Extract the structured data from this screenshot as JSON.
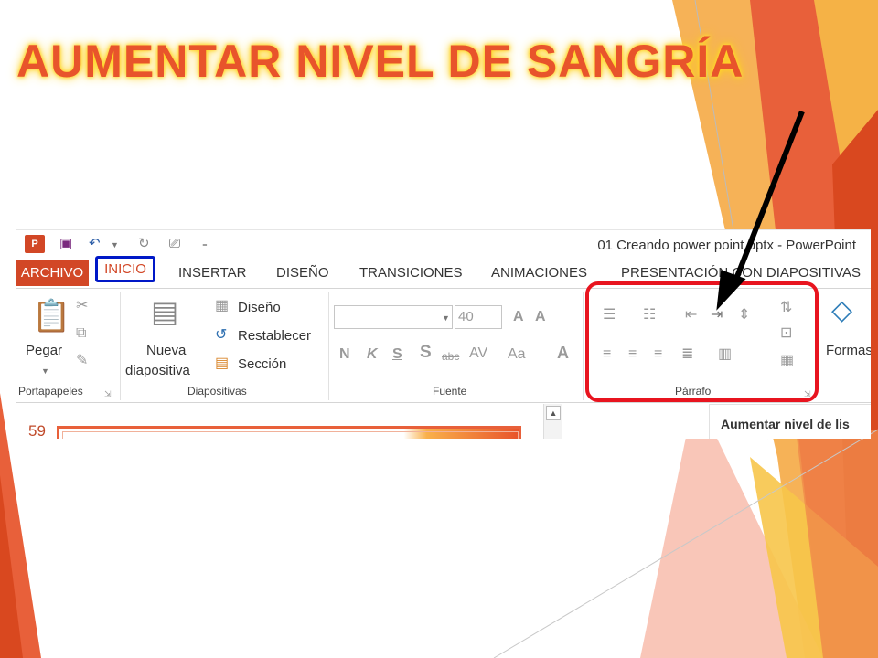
{
  "slide": {
    "title": "AUMENTAR NIVEL DE SANGRÍA",
    "accent_color": "#e8542b",
    "highlight_color": "#e8141f",
    "tab_highlight_color": "#0018c7"
  },
  "window": {
    "title": "01 Creando power point.pptx - PowerPoint",
    "app_icon": "P",
    "quick_access": [
      "save-icon",
      "undo-icon",
      "redo-icon",
      "presenter-icon"
    ]
  },
  "tabs": [
    "ARCHIVO",
    "INICIO",
    "INSERTAR",
    "DISEÑO",
    "TRANSICIONES",
    "ANIMACIONES",
    "PRESENTACIÓN CON DIAPOSITIVAS"
  ],
  "ribbon": {
    "portapapeles": {
      "label": "Portapapeles",
      "paste": "Pegar"
    },
    "diapositivas": {
      "label": "Diapositivas",
      "new_line1": "Nueva",
      "new_line2": "diapositiva",
      "design": "Diseño",
      "reset": "Restablecer",
      "section": "Sección"
    },
    "fuente": {
      "label": "Fuente",
      "size": "40",
      "bold": "N",
      "italic": "K",
      "underline": "S",
      "shadow": "S",
      "strike": "abc",
      "spacing": "AV",
      "case": "Aa",
      "color": "A",
      "grow": "A",
      "shrink": "A"
    },
    "parrafo": {
      "label": "Párrafo"
    },
    "formas": {
      "label": "Formas"
    }
  },
  "pane": {
    "slide_number": "59",
    "tooltip": "Aumentar nivel de lis"
  }
}
